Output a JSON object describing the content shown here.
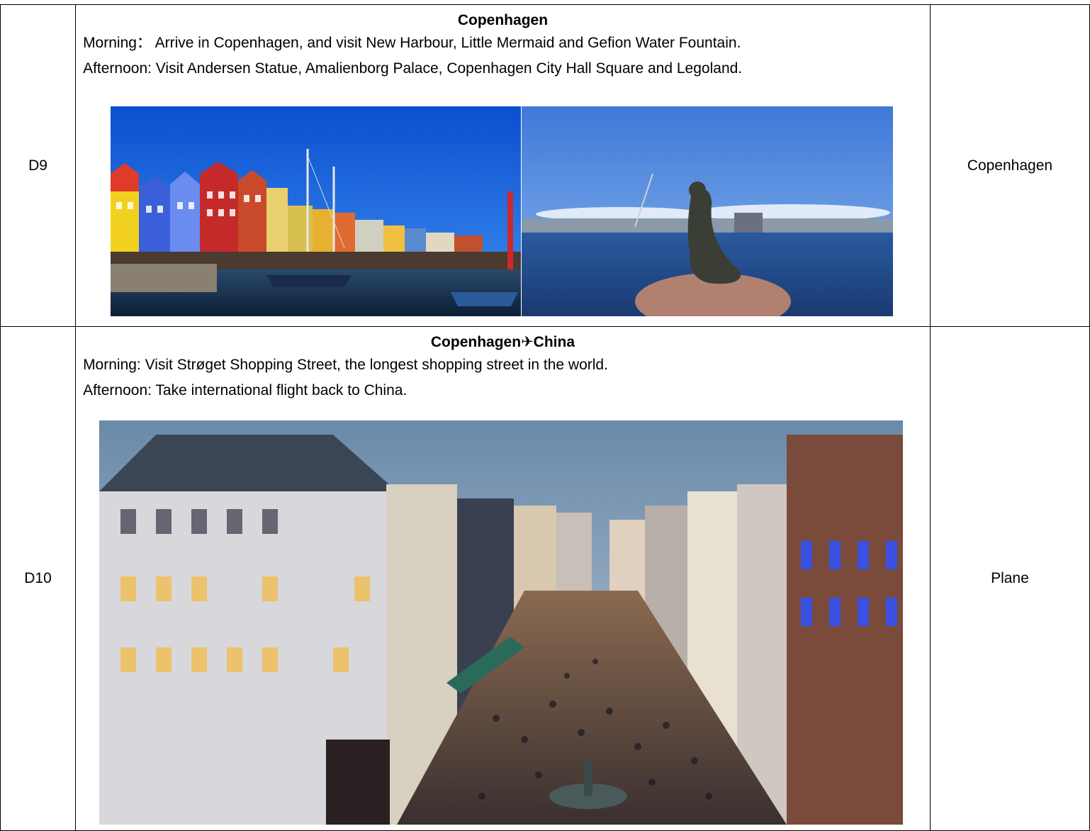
{
  "days": [
    {
      "day": "D9",
      "title": "Copenhagen",
      "morning": "Morning： Arrive in Copenhagen, and visit New Harbour, Little Mermaid and Gefion Water Fountain.",
      "afternoon": "Afternoon: Visit Andersen Statue, Amalienborg Palace, Copenhagen City Hall Square and Legoland.",
      "accommodation": "Copenhagen",
      "photos": [
        "Nyhavn colourful harbour houses with boats",
        "Little Mermaid statue on a rock by the sea"
      ]
    },
    {
      "day": "D10",
      "title_from": "Copenhagen",
      "title_icon": "✈",
      "title_to": "China",
      "morning": "Morning: Visit Strøget Shopping Street, the longest shopping street in the world.",
      "afternoon": "Afternoon: Take international flight back to China.",
      "accommodation": "Plane",
      "photos": [
        "Stroget pedestrian shopping street at dusk"
      ]
    }
  ],
  "colors": {
    "border": "#000000",
    "text": "#000000",
    "sky": "#1e64c8"
  }
}
